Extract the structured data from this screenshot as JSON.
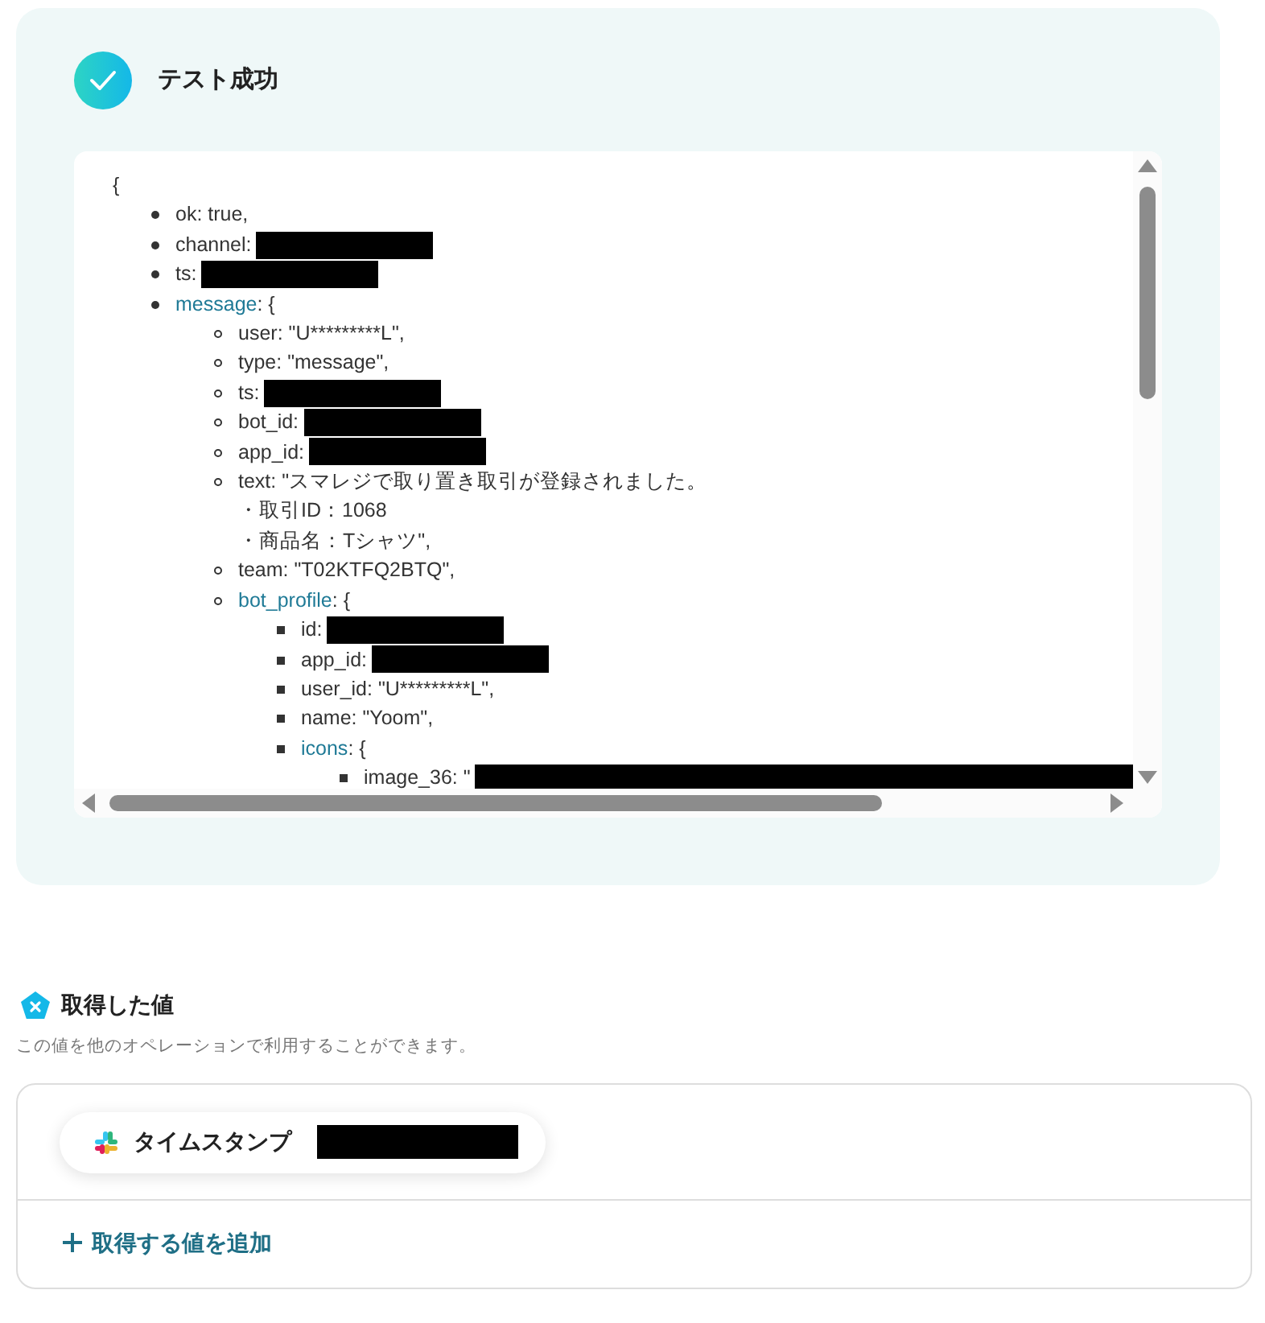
{
  "result": {
    "title": "テスト成功",
    "open_brace": "{",
    "items": [
      {
        "label": "ok: true,"
      },
      {
        "label": "channel:",
        "redacted": true
      },
      {
        "label": "ts:",
        "redacted": true
      },
      {
        "key": "message",
        "rest": ": {",
        "children": [
          {
            "label": "user: \"U*********L\","
          },
          {
            "label": "type: \"message\","
          },
          {
            "label": "ts:",
            "redacted": true
          },
          {
            "label": "bot_id:",
            "redacted": true
          },
          {
            "label": "app_id:",
            "redacted": true
          },
          {
            "lines": [
              "text: \"スマレジで取り置き取引が登録されました。",
              "・取引ID：1068",
              "・商品名：Tシャツ\","
            ]
          },
          {
            "label": "team: \"T02KTFQ2BTQ\","
          },
          {
            "key": "bot_profile",
            "rest": ": {",
            "children": [
              {
                "label": "id:",
                "redacted": true
              },
              {
                "label": "app_id:",
                "redacted": true
              },
              {
                "label": "user_id: \"U*********L\","
              },
              {
                "label": "name: \"Yoom\","
              },
              {
                "key": "icons",
                "rest": ": {",
                "children": [
                  {
                    "label": "image_36: \"",
                    "redacted": true,
                    "wide": true
                  }
                ]
              }
            ]
          }
        ]
      }
    ]
  },
  "values": {
    "title": "取得した値",
    "description": "この値を他のオペレーションで利用することができます。",
    "chips": [
      {
        "label": "タイムスタンプ",
        "redacted": true
      }
    ],
    "add_button": "取得する値を追加"
  }
}
